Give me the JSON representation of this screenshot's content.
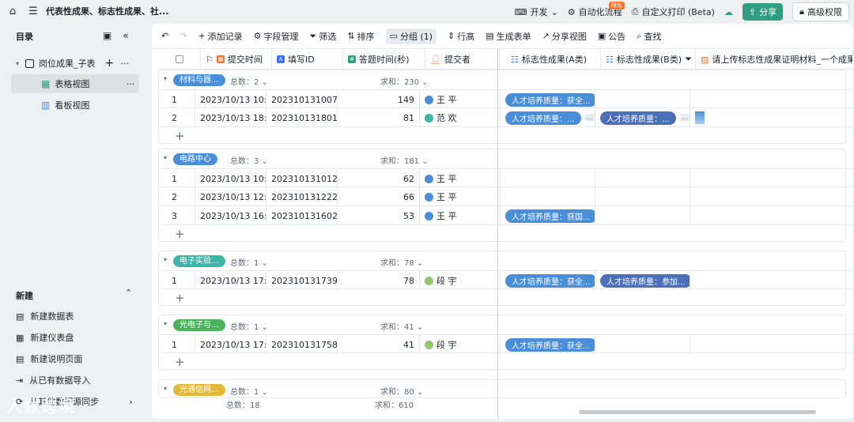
{
  "topbar": {
    "title": "代表性成果、标志性成果、社...",
    "dev": "开发",
    "automation": "自动化流程",
    "free_badge": "限免",
    "print": "自定义打印 (Beta)",
    "share": "分享",
    "permission": "高级权限"
  },
  "sidebar": {
    "title": "目录",
    "table_name": "岗位成果_子表",
    "views": [
      "表格视图",
      "看板视图"
    ],
    "new_title": "新建",
    "new_items": [
      "新建数据表",
      "新建仪表盘",
      "新建说明页面",
      "从已有数据导入",
      "从其他数据源同步"
    ]
  },
  "toolbar": {
    "add_record": "添加记录",
    "field_manage": "字段管理",
    "filter": "筛选",
    "sort": "排序",
    "group": "分组 (1)",
    "row_height": "行高",
    "gen_form": "生成表单",
    "share_view": "分享视图",
    "notice": "公告",
    "search": "查找"
  },
  "columns": [
    "提交时间",
    "填写ID",
    "答题时间(秒)",
    "提交者",
    "标志性成果(A类)",
    "标志性成果(B类)",
    "请上传标志性成果证明材料_一个成果对应"
  ],
  "groups": [
    {
      "tag": "材料与器...",
      "color": "#4a8ed9",
      "count": "总数：2",
      "sum": "求和：230",
      "rows": [
        {
          "idx": "1",
          "time": "2023/10/13 10:...",
          "id": "202310131007...",
          "secs": "149",
          "user": "王  平",
          "a": "人才培养质量：获全...",
          "a_more": "",
          "b": "",
          "b_more": "",
          "img": false
        },
        {
          "idx": "2",
          "time": "2023/10/13 18:...",
          "id": "202310131801...",
          "secs": "81",
          "user": "范  欢",
          "a": "人才培养质量：...",
          "a_more": "...",
          "b": "人才培养质量：...",
          "b_more": "...",
          "img": true
        }
      ]
    },
    {
      "tag": "电路中心",
      "color": "#4a8ed9",
      "count": "总数：3",
      "sum": "求和：181",
      "rows": [
        {
          "idx": "1",
          "time": "2023/10/13 10:...",
          "id": "202310131012...",
          "secs": "62",
          "user": "王  平",
          "a": "",
          "a_more": "",
          "b": "",
          "b_more": "",
          "img": false
        },
        {
          "idx": "2",
          "time": "2023/10/13 12:...",
          "id": "202310131222...",
          "secs": "66",
          "user": "王  平",
          "a": "",
          "a_more": "",
          "b": "",
          "b_more": "",
          "img": false
        },
        {
          "idx": "3",
          "time": "2023/10/13 16:...",
          "id": "202310131602...",
          "secs": "53",
          "user": "王  平",
          "a": "人才培养质量：获国...",
          "a_more": "",
          "b": "",
          "b_more": "",
          "img": false
        }
      ]
    },
    {
      "tag": "电子实验...",
      "color": "#3fb4a8",
      "count": "总数：1",
      "sum": "求和：78",
      "rows": [
        {
          "idx": "1",
          "time": "2023/10/13 17:...",
          "id": "202310131739...",
          "secs": "78",
          "user": "段  宇",
          "a": "人才培养质量：获全...",
          "a_more": "",
          "b": "人才培养质量：参加...",
          "b_more": "",
          "img": false
        }
      ]
    },
    {
      "tag": "光电子与...",
      "color": "#4cb35d",
      "count": "总数：1",
      "sum": "求和：41",
      "rows": [
        {
          "idx": "1",
          "time": "2023/10/13 17:...",
          "id": "202310131758...",
          "secs": "41",
          "user": "段  宇",
          "a": "人才培养质量：获全...",
          "a_more": "",
          "b": "",
          "b_more": "",
          "img": false
        }
      ]
    },
    {
      "tag": "光通信网...",
      "color": "#e4b93a",
      "count": "总数：1",
      "sum": "求和：80",
      "rows": []
    }
  ],
  "totals": {
    "count": "总数：18",
    "sum": "求和：610"
  },
  "watermark": "人数跨境"
}
